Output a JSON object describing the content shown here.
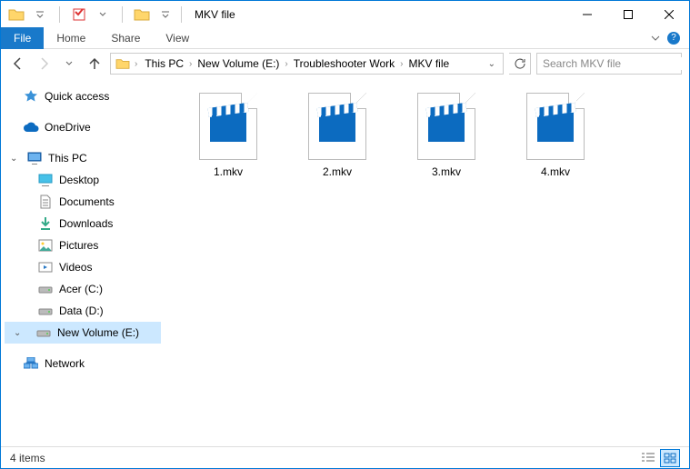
{
  "window": {
    "title": "MKV file"
  },
  "ribbon": {
    "file": "File",
    "tabs": [
      "Home",
      "Share",
      "View"
    ]
  },
  "nav": {
    "breadcrumbs": [
      "This PC",
      "New Volume (E:)",
      "Troubleshooter Work",
      "MKV file"
    ],
    "search_placeholder": "Search MKV file"
  },
  "sidebar": {
    "quick_access": "Quick access",
    "onedrive": "OneDrive",
    "this_pc": "This PC",
    "network": "Network",
    "pc_children": [
      {
        "label": "Desktop",
        "icon": "desktop"
      },
      {
        "label": "Documents",
        "icon": "documents"
      },
      {
        "label": "Downloads",
        "icon": "downloads"
      },
      {
        "label": "Pictures",
        "icon": "pictures"
      },
      {
        "label": "Videos",
        "icon": "videos"
      },
      {
        "label": "Acer (C:)",
        "icon": "drive"
      },
      {
        "label": "Data (D:)",
        "icon": "drive"
      },
      {
        "label": "New Volume (E:)",
        "icon": "drive",
        "selected": true
      }
    ]
  },
  "files": [
    {
      "name": "1.mkv"
    },
    {
      "name": "2.mkv"
    },
    {
      "name": "3.mkv"
    },
    {
      "name": "4.mkv"
    }
  ],
  "status": {
    "text": "4 items"
  }
}
